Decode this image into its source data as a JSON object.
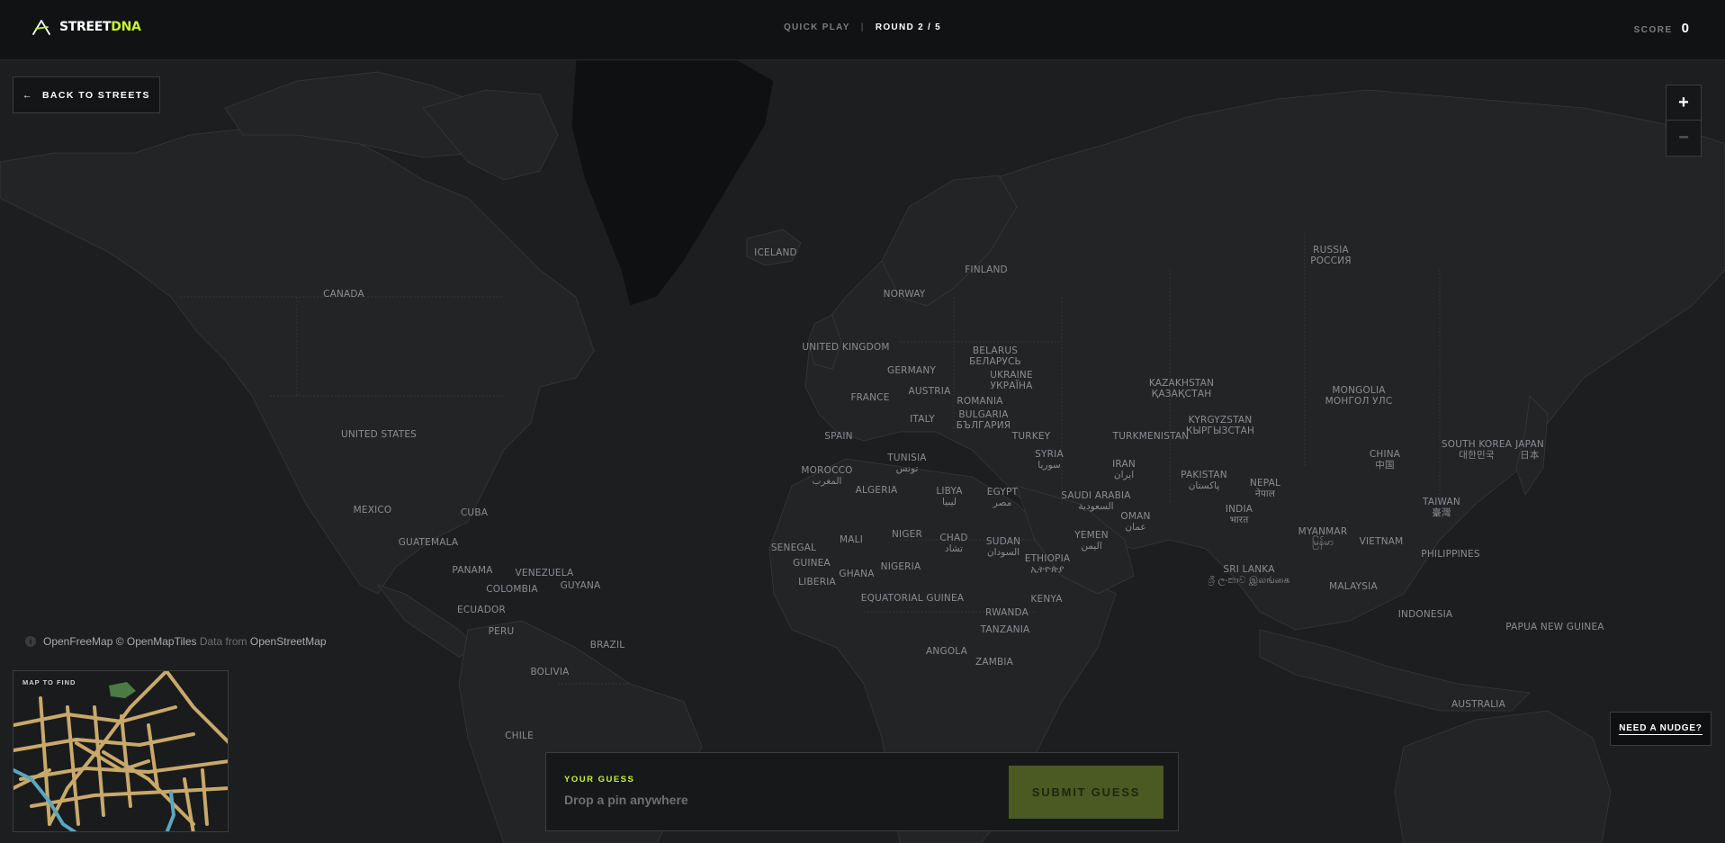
{
  "header": {
    "logo_prefix": "STREET",
    "logo_accent": "DNA",
    "mode": "QUICK PLAY",
    "separator": "|",
    "round": "ROUND 2 / 5",
    "score_label": "SCORE",
    "score_value": "0"
  },
  "controls": {
    "back_arrow": "←",
    "back_label": "BACK TO STREETS",
    "zoom_in": "+",
    "zoom_out": "−",
    "nudge_label": "NEED A NUDGE?"
  },
  "attribution": {
    "info": "i",
    "openfreemap": "OpenFreeMap",
    "copyright": "©",
    "openmaptiles": "OpenMapTiles",
    "data_from": "Data from",
    "openstreetmap": "OpenStreetMap"
  },
  "minimap": {
    "label": "MAP TO FIND"
  },
  "guess": {
    "label": "YOUR GUESS",
    "hint": "Drop a pin anywhere",
    "submit": "SUBMIT GUESS"
  },
  "colors": {
    "accent": "#c6f432",
    "submit_bg": "#4a5a22",
    "land": "#232426",
    "ocean": "#1d1e20",
    "minimap_roads": "#c9a96a",
    "minimap_water": "#5aa7c0",
    "minimap_park": "#4c7a44"
  },
  "map_labels": [
    "ICELAND",
    "FINLAND",
    "RUSSIA",
    "РОССИЯ",
    "CANADA",
    "NORWAY",
    "UNITED KINGDOM",
    "BELARUS",
    "БЕЛАРУСЬ",
    "GERMANY",
    "UKRAINE",
    "УКРАЇНА",
    "KAZAKHSTAN",
    "ҚАЗАҚСТАН",
    "MONGOLIA",
    "МОНГОЛ УЛС",
    "FRANCE",
    "AUSTRIA",
    "ROMANIA",
    "UNITED STATES",
    "BULGARIA",
    "БЪЛГАРИЯ",
    "ITALY",
    "KYRGYZSTAN",
    "КЫРГЫЗСТАН",
    "SPAIN",
    "TURKEY",
    "TURKMENISTAN",
    "SOUTH KOREA",
    "대한민국",
    "JAPAN",
    "日本",
    "TUNISIA",
    "تونس",
    "SYRIA",
    "سوريا",
    "CHINA",
    "中国",
    "MOROCCO",
    "المغرب",
    "IRAN",
    "ایران",
    "PAKISTAN",
    "پاکستان",
    "ALGERIA",
    "LIBYA",
    "ليبيا",
    "EGYPT",
    "مصر",
    "SAUDI ARABIA",
    "السعودية",
    "NEPAL",
    "नेपाल",
    "MEXICO",
    "TAIWAN",
    "臺灣",
    "CUBA",
    "INDIA",
    "भारत",
    "OMAN",
    "عمان",
    "MALI",
    "NIGER",
    "CHAD",
    "تشاد",
    "YEMEN",
    "اليمن",
    "MYANMAR",
    "မြန်မာ",
    "GUATEMALA",
    "SENEGAL",
    "SUDAN",
    "السودان",
    "VIETNAM",
    "PHILIPPINES",
    "GUINEA",
    "ETHIOPIA",
    "ኢትዮጵያ",
    "NIGERIA",
    "PANAMA",
    "VENEZUELA",
    "GHANA",
    "SRI LANKA",
    "ශ්‍රී ලංකාව இலங்கை",
    "COLOMBIA",
    "GUYANA",
    "LIBERIA",
    "MALAYSIA",
    "EQUATORIAL GUINEA",
    "KENYA",
    "ECUADOR",
    "INDONESIA",
    "RWANDA",
    "PAPUA NEW GUINEA",
    "PERU",
    "TANZANIA",
    "BRAZIL",
    "ANGOLA",
    "ZAMBIA",
    "BOLIVIA",
    "AUSTRALIA",
    "CHILE"
  ]
}
